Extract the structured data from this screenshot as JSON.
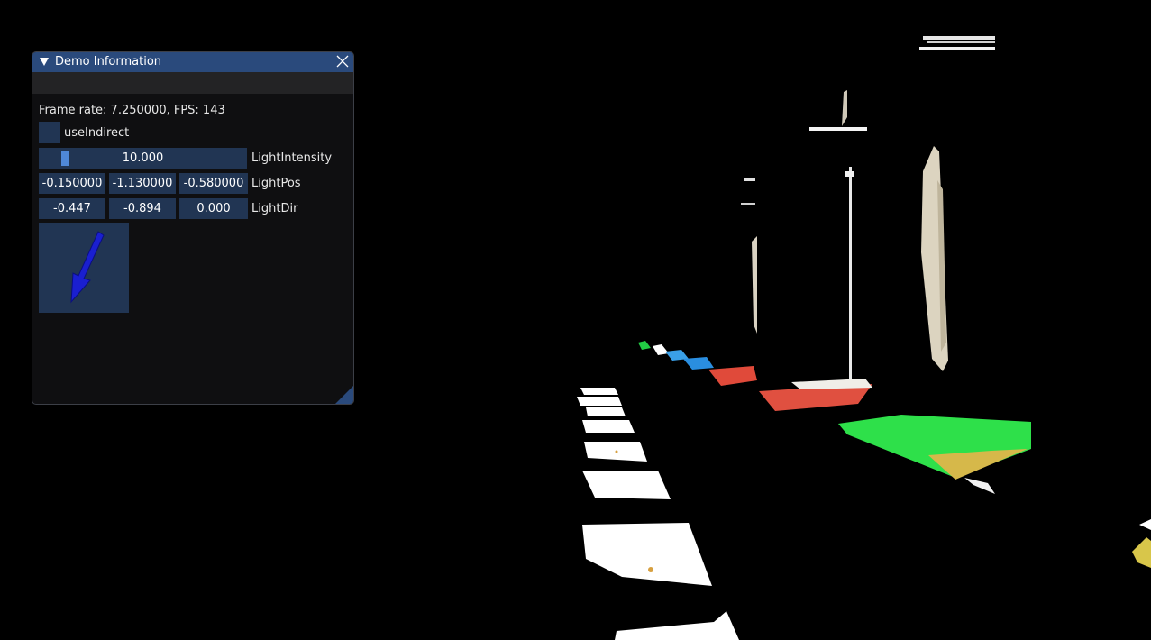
{
  "window": {
    "title": "Demo Information",
    "frame_rate_text": "Frame rate: 7.250000, FPS: 143",
    "use_indirect_label": "useIndirect",
    "use_indirect_checked": false,
    "light_intensity": {
      "value": "10.000",
      "label": "LightIntensity",
      "fraction": 0.06
    },
    "light_pos": {
      "x": "-0.150000",
      "y": "-1.130000",
      "z": "-0.580000",
      "label": "LightPos"
    },
    "light_dir": {
      "x": "-0.447",
      "y": "-0.894",
      "z": "0.000",
      "label": "LightDir"
    },
    "direction_gizmo_icon": "blue-arrow-icon"
  },
  "colors": {
    "title_bar": "#2a4a7c",
    "widget_bg": "#213553",
    "slider_grab": "#4f88d8",
    "arrow": "#1a1fd0"
  }
}
